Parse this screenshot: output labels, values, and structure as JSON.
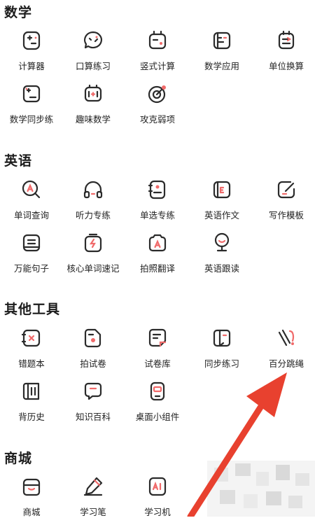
{
  "sections": {
    "math": {
      "title": "数学",
      "items": [
        "计算器",
        "口算练习",
        "竖式计算",
        "数学应用",
        "单位换算",
        "数学同步练",
        "趣味数学",
        "攻克弱项"
      ]
    },
    "english": {
      "title": "英语",
      "items": [
        "单词查询",
        "听力专练",
        "单选专练",
        "英语作文",
        "写作模板",
        "万能句子",
        "核心单词速记",
        "拍照翻译",
        "英语跟读"
      ]
    },
    "tools": {
      "title": "其他工具",
      "items": [
        "错题本",
        "拍试卷",
        "试卷库",
        "同步练习",
        "百分跳绳",
        "背历史",
        "知识百科",
        "桌面小组件"
      ]
    },
    "mall": {
      "title": "商城",
      "items": [
        "商城",
        "学习笔",
        "学习机"
      ]
    }
  },
  "colors": {
    "accent": "#e8412f",
    "icon_stroke": "#2b2b2b",
    "icon_accent": "#f06a6a"
  }
}
